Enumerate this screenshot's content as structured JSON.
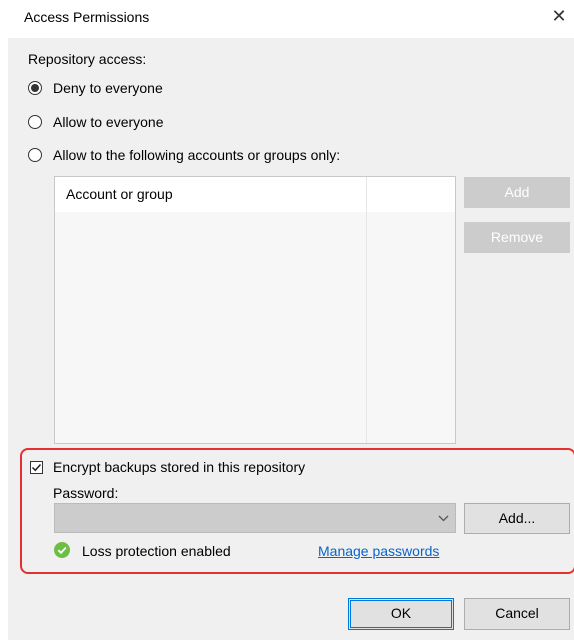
{
  "window": {
    "title": "Access Permissions",
    "close_glyph": "✕"
  },
  "repository_access": {
    "heading": "Repository access:",
    "options": [
      {
        "label": "Deny to everyone",
        "selected": true
      },
      {
        "label": "Allow to everyone",
        "selected": false
      },
      {
        "label": "Allow to the following accounts or groups only:",
        "selected": false
      }
    ]
  },
  "accounts_list": {
    "column_header": "Account or group",
    "rows": []
  },
  "side_buttons": {
    "add": "Add",
    "remove": "Remove"
  },
  "encryption": {
    "checkbox_label": "Encrypt backups stored in this repository",
    "checked": true,
    "password_label": "Password:",
    "password_value": "",
    "add_button": "Add...",
    "status_text": "Loss protection enabled",
    "status_icon": "check-circle-icon",
    "manage_link": "Manage passwords"
  },
  "footer": {
    "ok": "OK",
    "cancel": "Cancel"
  },
  "colors": {
    "link": "#0a64c8",
    "highlight_border": "#e53030",
    "status_green": "#6cbf44",
    "default_button_border": "#0078d7"
  }
}
